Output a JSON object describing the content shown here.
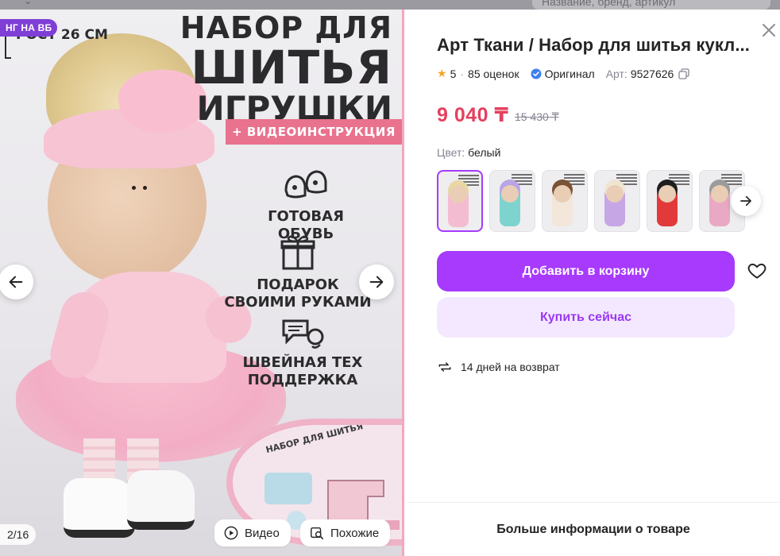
{
  "backdrop": {
    "search_placeholder": "Название, бренд, артикул"
  },
  "gallery": {
    "promo_badge": "НГ НА ВБ",
    "poster": {
      "size_tag": "РОСТ 26 СМ",
      "title_line1": "НАБОР ДЛЯ",
      "title_line2": "ШИТЬЯ",
      "title_line3": "ИГРУШКИ",
      "ribbon": "+ ВИДЕОИНСТРУКЦИЯ",
      "features": [
        {
          "icon": "shoes-icon",
          "label": "ГОТОВАЯ ОБУВЬ"
        },
        {
          "icon": "gift-box-icon",
          "label": "ПОДАРОК СВОИМИ РУКАМИ"
        },
        {
          "icon": "chat-support-icon",
          "label": "ШВЕЙНАЯ ТЕХ ПОДДЕРЖКА"
        }
      ],
      "kit_label": "НАБОР ДЛЯ ШИТЬЯ"
    },
    "counter": "2/16",
    "video_label": "Видео",
    "similar_label": "Похожие"
  },
  "product": {
    "title": "Арт Ткани / Набор для шитья кукл...",
    "rating": "5",
    "reviews": "85 оценок",
    "original_label": "Оригинал",
    "article_label": "Арт:",
    "article_value": "9527626",
    "price_current": "9 040 ₸",
    "price_old": "15 430 ₸",
    "color_label": "Цвет:",
    "color_value": "белый",
    "variants": [
      {
        "dress": "#f4bcd0",
        "hair": "#e8d6a4",
        "selected": true
      },
      {
        "dress": "#7fd3cf",
        "hair": "#b9a4e6",
        "selected": false
      },
      {
        "dress": "#f2e7da",
        "hair": "#7a5234",
        "selected": false
      },
      {
        "dress": "#c7a6e6",
        "hair": "#efe6d2",
        "selected": false
      },
      {
        "dress": "#e23a3a",
        "hair": "#1e1e1e",
        "selected": false
      },
      {
        "dress": "#e9a9c4",
        "hair": "#9b9b9b",
        "selected": false
      }
    ],
    "add_to_cart": "Добавить в корзину",
    "buy_now": "Купить сейчас",
    "returns": "14 дней на возврат",
    "more_info": "Больше информации о товаре"
  },
  "colors": {
    "accent": "#a73afd",
    "accent_light": "#f3e8ff",
    "price": "#e4405f",
    "muted": "#868695",
    "badge": "#7f3fd6"
  }
}
